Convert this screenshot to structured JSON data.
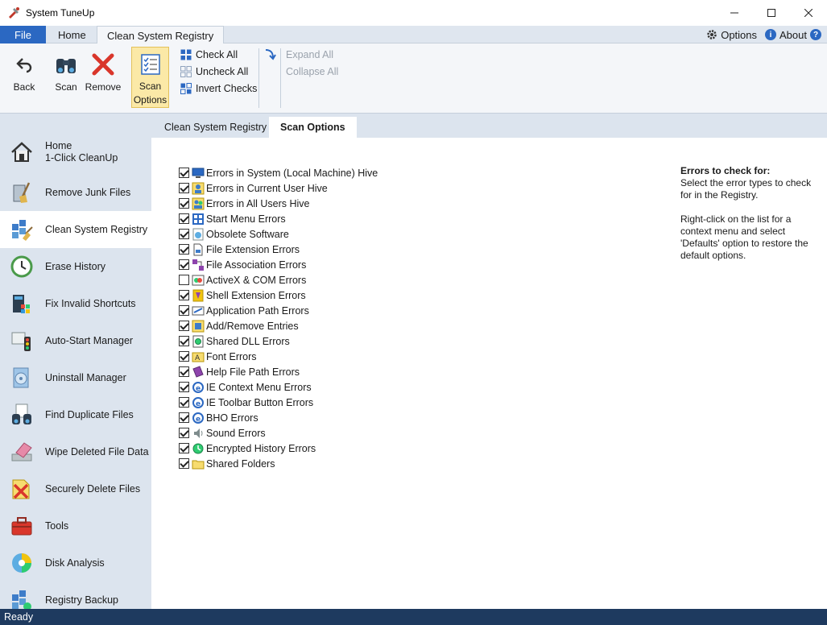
{
  "window": {
    "title": "System TuneUp",
    "controls": [
      "—",
      "☐",
      "✕"
    ]
  },
  "ribbon_tabs": {
    "file": "File",
    "home": "Home",
    "clean": "Clean System Registry"
  },
  "right_links": {
    "options": "Options",
    "about": "About"
  },
  "ribbon": {
    "back": "Back",
    "scan": "Scan",
    "remove": "Remove",
    "scan_options_1": "Scan",
    "scan_options_2": "Options",
    "check_all": "Check All",
    "uncheck_all": "Uncheck All",
    "invert_checks": "Invert Checks",
    "expand_all": "Expand All",
    "collapse_all": "Collapse All"
  },
  "sidebar": {
    "items": [
      {
        "line1": "Home",
        "line2": "1-Click CleanUp",
        "icon": "home-icon"
      },
      {
        "line1": "Remove Junk Files",
        "icon": "broom-icon"
      },
      {
        "line1": "Clean System Registry",
        "icon": "registry-icon"
      },
      {
        "line1": "Erase History",
        "icon": "clock-icon"
      },
      {
        "line1": "Fix Invalid Shortcuts",
        "icon": "shortcut-icon"
      },
      {
        "line1": "Auto-Start Manager",
        "icon": "traffic-light-icon"
      },
      {
        "line1": "Uninstall Manager",
        "icon": "disc-icon"
      },
      {
        "line1": "Find Duplicate Files",
        "icon": "binoculars-icon"
      },
      {
        "line1": "Wipe Deleted File Data",
        "icon": "eraser-icon"
      },
      {
        "line1": "Securely Delete Files",
        "icon": "delete-file-icon"
      },
      {
        "line1": "Tools",
        "icon": "toolbox-icon"
      },
      {
        "line1": "Disk Analysis",
        "icon": "pie-disk-icon"
      },
      {
        "line1": "Registry Backup",
        "icon": "backup-icon"
      }
    ]
  },
  "content_tabs": {
    "clean": "Clean System Registry",
    "scan_options": "Scan Options"
  },
  "checklist": [
    {
      "label": "Errors in System (Local Machine) Hive",
      "checked": true
    },
    {
      "label": "Errors in Current User Hive",
      "checked": true
    },
    {
      "label": "Errors in All Users Hive",
      "checked": true
    },
    {
      "label": "Start Menu Errors",
      "checked": true
    },
    {
      "label": "Obsolete Software",
      "checked": true
    },
    {
      "label": "File Extension Errors",
      "checked": true
    },
    {
      "label": "File Association Errors",
      "checked": true
    },
    {
      "label": "ActiveX & COM Errors",
      "checked": false
    },
    {
      "label": "Shell Extension Errors",
      "checked": true
    },
    {
      "label": "Application Path Errors",
      "checked": true
    },
    {
      "label": "Add/Remove Entries",
      "checked": true
    },
    {
      "label": "Shared DLL Errors",
      "checked": true
    },
    {
      "label": "Font Errors",
      "checked": true
    },
    {
      "label": "Help File Path Errors",
      "checked": true
    },
    {
      "label": "IE Context Menu Errors",
      "checked": true
    },
    {
      "label": "IE Toolbar Button Errors",
      "checked": true
    },
    {
      "label": "BHO Errors",
      "checked": true
    },
    {
      "label": "Sound Errors",
      "checked": true
    },
    {
      "label": "Encrypted History Errors",
      "checked": true
    },
    {
      "label": "Shared Folders",
      "checked": true
    }
  ],
  "help": {
    "heading": "Errors to check for:",
    "p1": "Select the error types to check for in the Registry.",
    "p2": "Right-click on the list for a context menu and select 'Defaults' option to restore the default options."
  },
  "status": {
    "text": "Ready"
  },
  "colors": {
    "accent": "#2b68c2",
    "sidebar": "#dce4ee",
    "status": "#1e3a5f",
    "selected": "#fbe9a7"
  }
}
